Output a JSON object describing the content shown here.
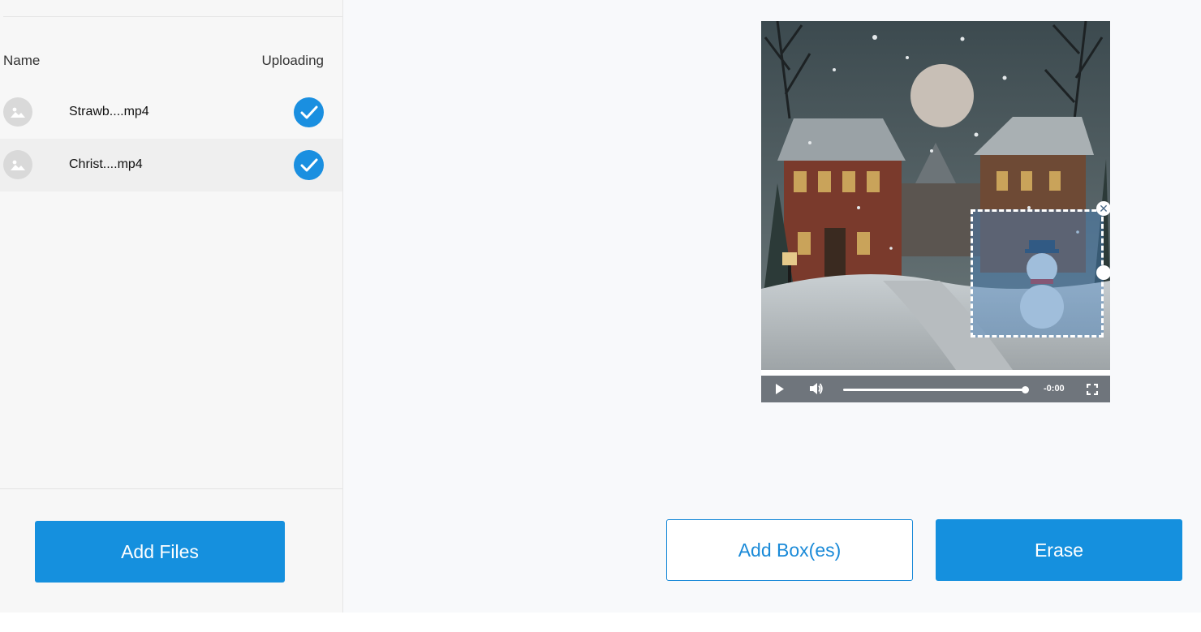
{
  "file_list": {
    "header_name": "Name",
    "header_uploading": "Uploading",
    "files": [
      {
        "name": "Strawb....mp4",
        "status": "uploaded",
        "thumb_icon": "image-placeholder-icon"
      },
      {
        "name": "Christ....mp4",
        "status": "uploaded",
        "thumb_icon": "image-placeholder-icon"
      }
    ],
    "add_files_label": "Add Files"
  },
  "video_player": {
    "time_remaining": "-0:00",
    "progress": 1.0,
    "controls": [
      "play-icon",
      "volume-icon",
      "fullscreen-icon"
    ]
  },
  "actions": {
    "add_box_label": "Add Box(es)",
    "erase_label": "Erase"
  },
  "colors": {
    "accent": "#1590de",
    "check": "#1a8fe0"
  }
}
